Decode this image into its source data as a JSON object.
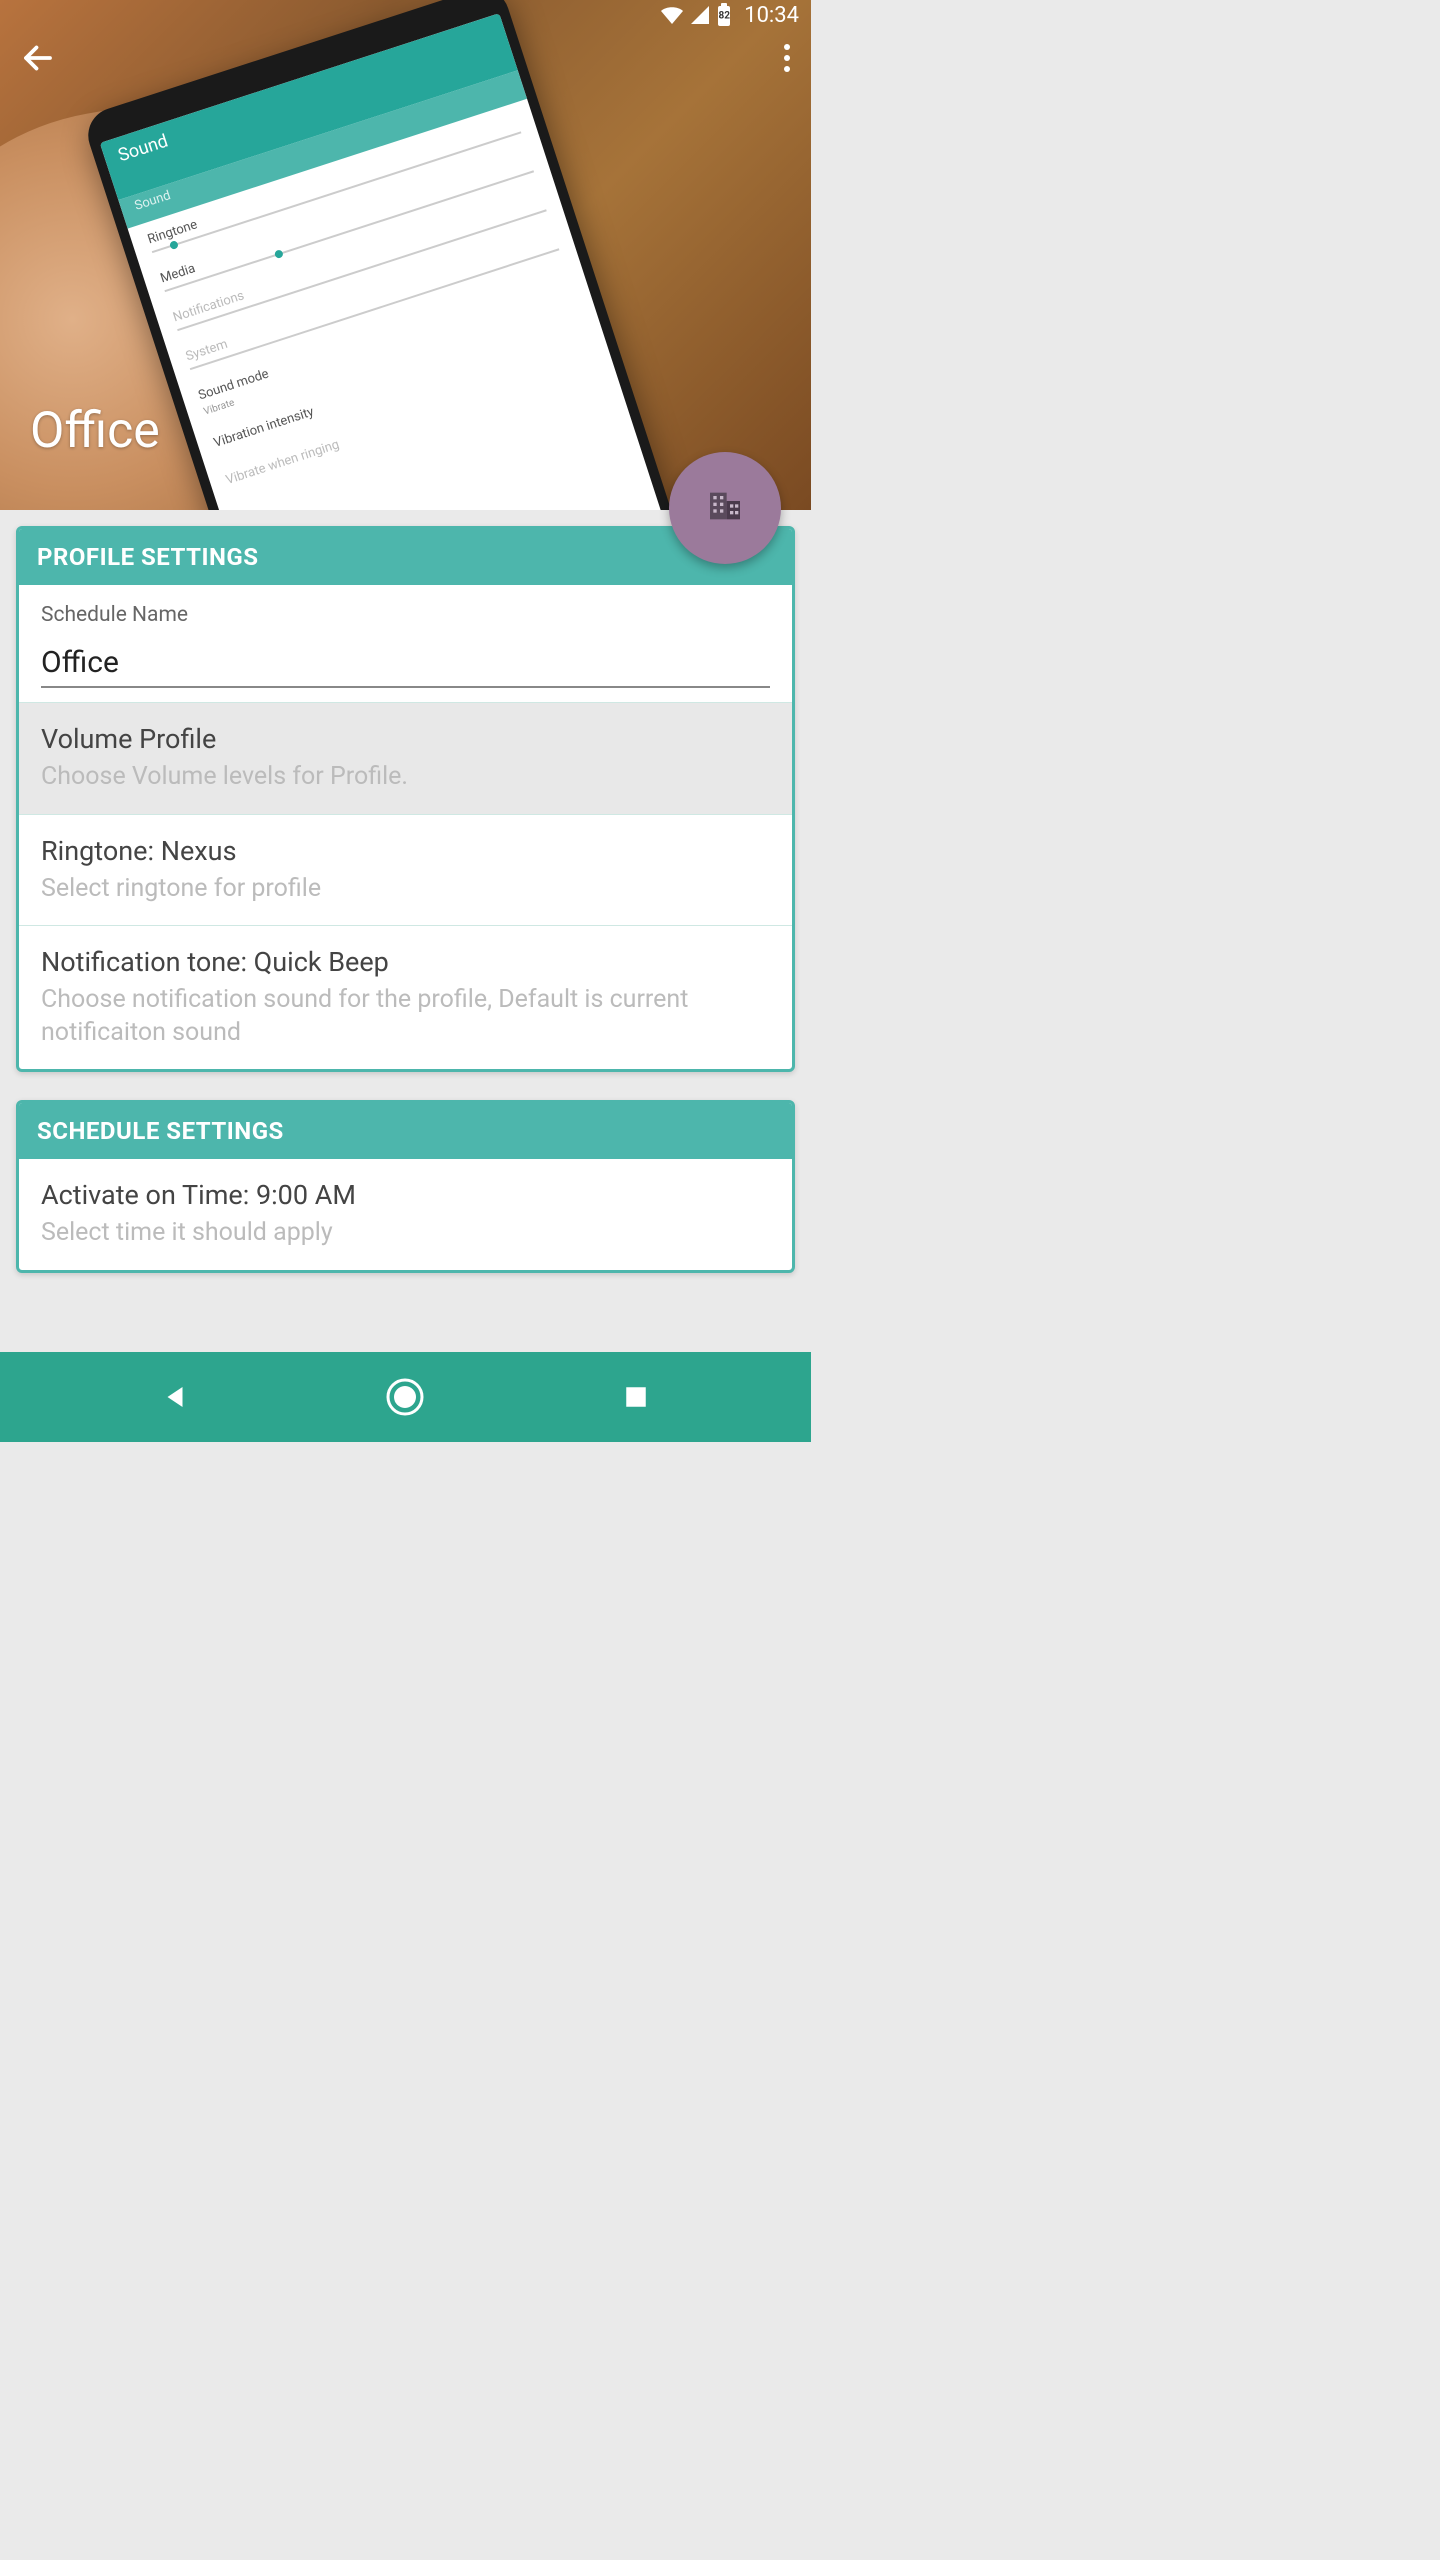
{
  "statusbar": {
    "battery": "82",
    "time": "10:34"
  },
  "header": {
    "title": "Office"
  },
  "profile_settings": {
    "header": "PROFILE SETTINGS",
    "schedule_name_label": "Schedule Name",
    "schedule_name_value": "Office",
    "volume_profile": {
      "title": "Volume Profile",
      "subtitle": "Choose Volume levels for Profile."
    },
    "ringtone": {
      "title": "Ringtone: Nexus",
      "subtitle": "Select ringtone for profile"
    },
    "notification_tone": {
      "title": "Notification tone: Quick Beep",
      "subtitle": "Choose notification sound for the profile, Default is current notificaiton sound"
    }
  },
  "schedule_settings": {
    "header": "SCHEDULE SETTINGS",
    "activate_time": {
      "title": "Activate on Time: 9:00 AM",
      "subtitle": "Select time it should apply"
    }
  }
}
